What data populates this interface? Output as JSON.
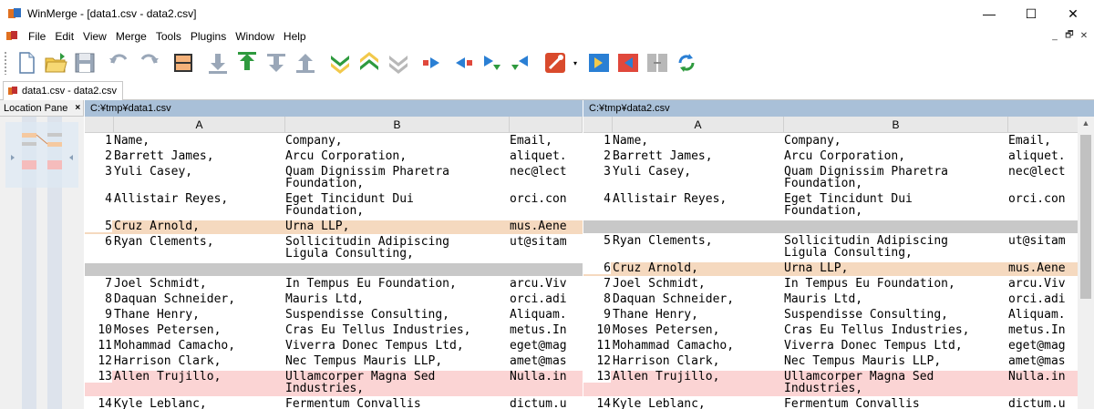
{
  "window": {
    "title": "WinMerge - [data1.csv - data2.csv]",
    "minimize": "—",
    "maximize": "☐",
    "close": "✕"
  },
  "menu": {
    "items": [
      "File",
      "Edit",
      "View",
      "Merge",
      "Tools",
      "Plugins",
      "Window",
      "Help"
    ],
    "mdi_min": "_",
    "mdi_restore": "🗗",
    "mdi_close": "✕"
  },
  "toolbar": {
    "icons": [
      "new-icon",
      "open-icon",
      "save-icon",
      "undo-icon",
      "redo-icon",
      "line-diff-icon",
      "next-diff-down-icon",
      "prev-diff-up-icon",
      "last-diff-icon",
      "first-diff-icon",
      "next-conflict-icon",
      "prev-conflict-icon",
      "all-conflict-icon",
      "copy-right-icon",
      "copy-left-icon",
      "copy-right-advance-icon",
      "copy-left-advance-icon",
      "options-icon",
      "merge-right-all-icon",
      "merge-left-all-icon",
      "compare-icon",
      "refresh-icon"
    ]
  },
  "tab": {
    "label": "data1.csv - data2.csv"
  },
  "location_pane": {
    "label": "Location Pane",
    "close": "×"
  },
  "left": {
    "path": "C:¥tmp¥data1.csv",
    "columns": [
      "A",
      "B"
    ],
    "rows": [
      {
        "n": "1",
        "a": "Name,",
        "b": "Company,",
        "c": "Email,",
        "type": "same"
      },
      {
        "n": "2",
        "a": "Barrett James,",
        "b": "Arcu Corporation,",
        "c": "aliquet.",
        "type": "same"
      },
      {
        "n": "3",
        "a": "Yuli Casey,",
        "b": "Quam Dignissim Pharetra\nFoundation,",
        "c": "nec@lect",
        "type": "same"
      },
      {
        "n": "4",
        "a": "Allistair Reyes,",
        "b": "Eget Tincidunt Dui\nFoundation,",
        "c": "orci.con",
        "type": "same"
      },
      {
        "n": "5",
        "a": "Cruz Arnold,",
        "b": "Urna LLP,",
        "c": "mus.Aene",
        "type": "moved"
      },
      {
        "n": "6",
        "a": "Ryan Clements,",
        "b": "Sollicitudin Adipiscing\nLigula Consulting,",
        "c": "ut@sitam",
        "type": "same"
      },
      {
        "n": "",
        "a": "",
        "b": "",
        "c": "",
        "type": "gap"
      },
      {
        "n": "7",
        "a": "Joel Schmidt,",
        "b": "In Tempus Eu Foundation,",
        "c": "arcu.Viv",
        "type": "same"
      },
      {
        "n": "8",
        "a": "Daquan Schneider,",
        "b": "Mauris Ltd,",
        "c": "orci.adi",
        "type": "same"
      },
      {
        "n": "9",
        "a": "Thane Henry,",
        "b": "Suspendisse Consulting,",
        "c": "Aliquam.",
        "type": "same"
      },
      {
        "n": "10",
        "a": "Moses Petersen,",
        "b": "Cras Eu Tellus Industries,",
        "c": "metus.In",
        "type": "same"
      },
      {
        "n": "11",
        "a": "Mohammad Camacho,",
        "b": "Viverra Donec Tempus Ltd,",
        "c": "eget@mag",
        "type": "same"
      },
      {
        "n": "12",
        "a": "Harrison Clark,",
        "b": "Nec Tempus Mauris LLP,",
        "c": "amet@mas",
        "type": "same"
      },
      {
        "n": "13",
        "a": "Allen Trujillo,",
        "b": "Ullamcorper Magna Sed\nIndustries,",
        "c": "Nulla.in",
        "type": "diff"
      },
      {
        "n": "14",
        "a": "Kyle Leblanc,",
        "b": "Fermentum Convallis\nInstitute,",
        "c": "dictum.u",
        "type": "same"
      }
    ]
  },
  "right": {
    "path": "C:¥tmp¥data2.csv",
    "columns": [
      "A",
      "B"
    ],
    "rows": [
      {
        "n": "1",
        "a": "Name,",
        "b": "Company,",
        "c": "Email,",
        "type": "same"
      },
      {
        "n": "2",
        "a": "Barrett James,",
        "b": "Arcu Corporation,",
        "c": "aliquet.",
        "type": "same"
      },
      {
        "n": "3",
        "a": "Yuli Casey,",
        "b": "Quam Dignissim Pharetra\nFoundation,",
        "c": "nec@lect",
        "type": "same"
      },
      {
        "n": "4",
        "a": "Allistair Reyes,",
        "b": "Eget Tincidunt Dui\nFoundation,",
        "c": "orci.con",
        "type": "same"
      },
      {
        "n": "",
        "a": "",
        "b": "",
        "c": "",
        "type": "gap"
      },
      {
        "n": "5",
        "a": "Ryan Clements,",
        "b": "Sollicitudin Adipiscing\nLigula Consulting,",
        "c": "ut@sitam",
        "type": "same"
      },
      {
        "n": "6",
        "a": "Cruz Arnold,",
        "b": "Urna LLP,",
        "c": "mus.Aene",
        "type": "moved"
      },
      {
        "n": "7",
        "a": "Joel Schmidt,",
        "b": "In Tempus Eu Foundation,",
        "c": "arcu.Viv",
        "type": "same"
      },
      {
        "n": "8",
        "a": "Daquan Schneider,",
        "b": "Mauris Ltd,",
        "c": "orci.adi",
        "type": "same"
      },
      {
        "n": "9",
        "a": "Thane Henry,",
        "b": "Suspendisse Consulting,",
        "c": "Aliquam.",
        "type": "same"
      },
      {
        "n": "10",
        "a": "Moses Petersen,",
        "b": "Cras Eu Tellus Industries,",
        "c": "metus.In",
        "type": "same"
      },
      {
        "n": "11",
        "a": "Mohammad Camacho,",
        "b": "Viverra Donec Tempus Ltd,",
        "c": "eget@mag",
        "type": "same"
      },
      {
        "n": "12",
        "a": "Harrison Clark,",
        "b": "Nec Tempus Mauris LLP,",
        "c": "amet@mas",
        "type": "same"
      },
      {
        "n": "13",
        "a": "Allen Trujillo,",
        "b": "Ullamcorper Magna Sed\nIndustries,",
        "c": "Nulla.in",
        "type": "diff"
      },
      {
        "n": "14",
        "a": "Kyle Leblanc,",
        "b": "Fermentum Convallis\nInstitute,",
        "c": "dictum.u",
        "type": "same"
      }
    ]
  },
  "colors": {
    "moved": "#f5d9bf",
    "diff": "#fbd4d4",
    "gap": "#c8c8c8",
    "path_bar": "#a9c0d8"
  }
}
